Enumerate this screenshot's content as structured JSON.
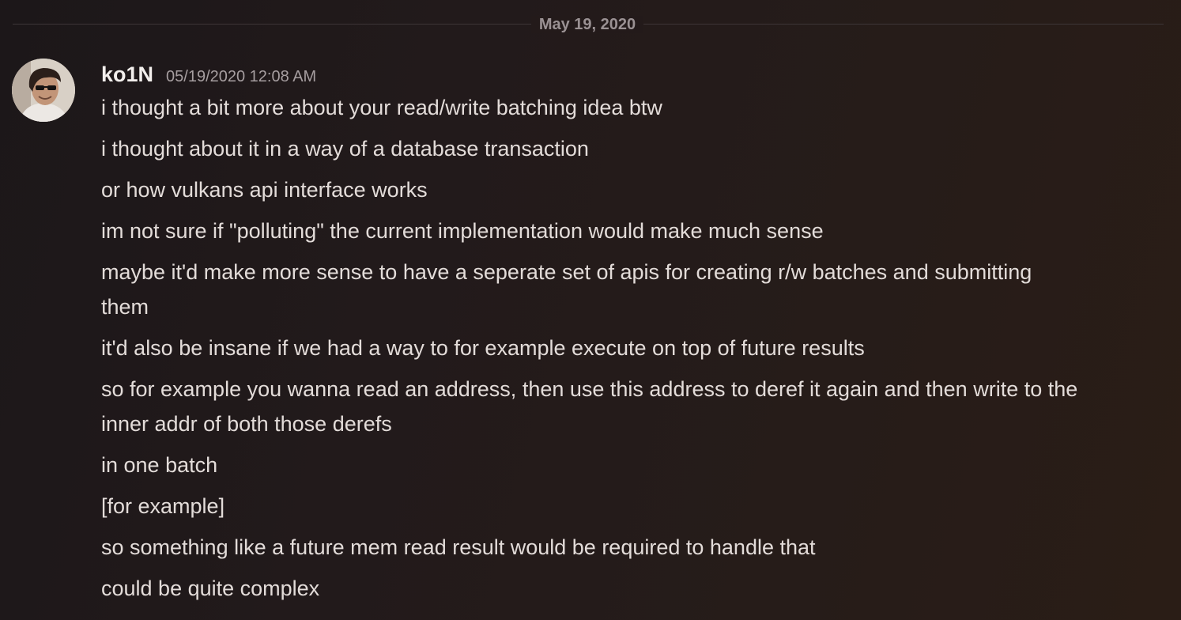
{
  "date_divider": "May 19, 2020",
  "message": {
    "author": "ko1N",
    "timestamp": "05/19/2020 12:08 AM",
    "avatar_icon": "user-avatar-photo",
    "lines": [
      "i thought a bit more about your read/write batching idea btw",
      "i thought about it in a way of a database transaction",
      "or how vulkans api interface works",
      "im not sure if \"polluting\" the current implementation would make much sense",
      "maybe it'd make more sense to have a seperate set of apis for creating r/w batches and submitting them",
      "it'd also be insane if we had a way to for example execute on top of future results",
      "so for example you wanna read an address, then use this address to deref it again and then write to the inner addr of both those derefs",
      "in one batch",
      "[for example]",
      "so something like a future mem read result would be required to handle that",
      "could be quite complex"
    ]
  }
}
